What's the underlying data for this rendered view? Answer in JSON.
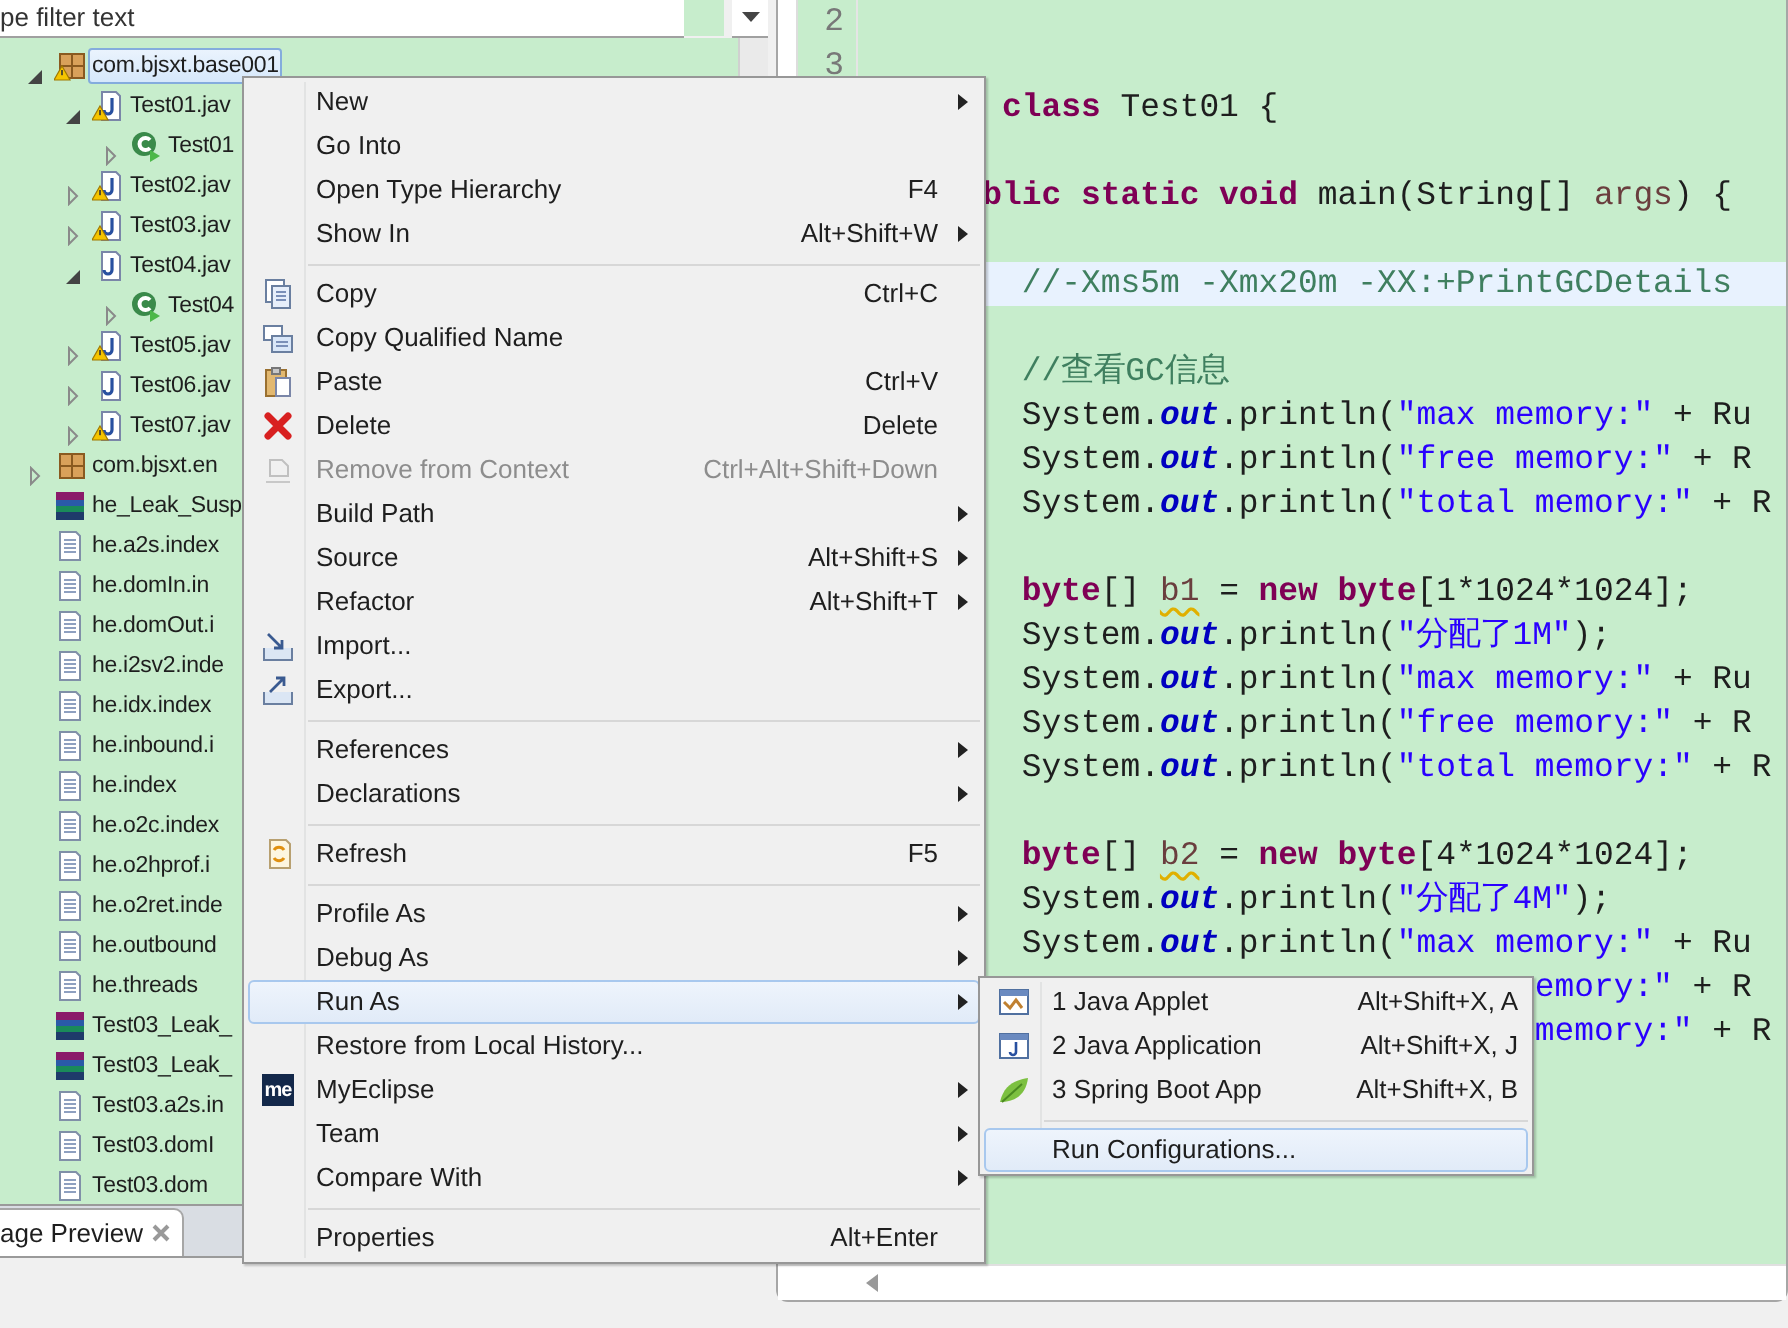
{
  "filter": {
    "placeholder": "pe filter text"
  },
  "tree": [
    {
      "label": "com.bjsxt.base001",
      "kind": "package",
      "warning": true,
      "expanded": true,
      "selected": true,
      "children": [
        {
          "label": "Test01.jav",
          "kind": "java",
          "warning": true,
          "expanded": true,
          "selected": false,
          "children": [
            {
              "label": "Test01",
              "kind": "runnable-class",
              "warning": false,
              "expanded": false,
              "selected": false
            }
          ]
        },
        {
          "label": "Test02.jav",
          "kind": "java",
          "warning": true,
          "expanded": false,
          "selected": false
        },
        {
          "label": "Test03.jav",
          "kind": "java",
          "warning": true,
          "expanded": false,
          "selected": false
        },
        {
          "label": "Test04.jav",
          "kind": "java",
          "warning": false,
          "expanded": true,
          "selected": false,
          "children": [
            {
              "label": "Test04",
              "kind": "runnable-class",
              "warning": false,
              "expanded": false,
              "selected": false
            }
          ]
        },
        {
          "label": "Test05.jav",
          "kind": "java",
          "warning": true,
          "expanded": false,
          "selected": false
        },
        {
          "label": "Test06.jav",
          "kind": "java",
          "warning": false,
          "expanded": false,
          "selected": false
        },
        {
          "label": "Test07.jav",
          "kind": "java",
          "warning": true,
          "expanded": false,
          "selected": false
        }
      ]
    },
    {
      "label": "com.bjsxt.en",
      "kind": "package",
      "warning": false,
      "expanded": false,
      "selected": false
    },
    {
      "label": "he_Leak_Susp",
      "kind": "archive",
      "warning": false,
      "selected": false
    },
    {
      "label": "he.a2s.index",
      "kind": "text",
      "warning": false,
      "selected": false
    },
    {
      "label": "he.domIn.in",
      "kind": "text",
      "warning": false,
      "selected": false
    },
    {
      "label": "he.domOut.i",
      "kind": "text",
      "warning": false,
      "selected": false
    },
    {
      "label": "he.i2sv2.inde",
      "kind": "text",
      "warning": false,
      "selected": false
    },
    {
      "label": "he.idx.index",
      "kind": "text",
      "warning": false,
      "selected": false
    },
    {
      "label": "he.inbound.i",
      "kind": "text",
      "warning": false,
      "selected": false
    },
    {
      "label": "he.index",
      "kind": "text",
      "warning": false,
      "selected": false
    },
    {
      "label": "he.o2c.index",
      "kind": "text",
      "warning": false,
      "selected": false
    },
    {
      "label": "he.o2hprof.i",
      "kind": "text",
      "warning": false,
      "selected": false
    },
    {
      "label": "he.o2ret.inde",
      "kind": "text",
      "warning": false,
      "selected": false
    },
    {
      "label": "he.outbound",
      "kind": "text",
      "warning": false,
      "selected": false
    },
    {
      "label": "he.threads",
      "kind": "text",
      "warning": false,
      "selected": false
    },
    {
      "label": "Test03_Leak_",
      "kind": "archive",
      "warning": false,
      "selected": false
    },
    {
      "label": "Test03_Leak_",
      "kind": "archive",
      "warning": false,
      "selected": false
    },
    {
      "label": "Test03.a2s.in",
      "kind": "text",
      "warning": false,
      "selected": false
    },
    {
      "label": "Test03.domI",
      "kind": "text",
      "warning": false,
      "selected": false
    },
    {
      "label": "Test03.dom",
      "kind": "text",
      "warning": false,
      "selected": false
    }
  ],
  "bottom_tab": {
    "label": "age Preview"
  },
  "editor": {
    "line_numbers": [
      "2",
      "3"
    ],
    "lines": [
      {
        "kind": "class",
        "highlighted": false,
        "tokens": [
          {
            "kind": "keyword",
            "text": "class"
          },
          {
            "kind": "plain",
            "text": " Test01 {"
          }
        ]
      },
      {
        "kind": "blank",
        "highlighted": false
      },
      {
        "kind": "method",
        "highlighted": false,
        "tokens": [
          {
            "kind": "keyword",
            "text": "blic static void"
          },
          {
            "kind": "plain",
            "text": " main(String[] "
          },
          {
            "kind": "param",
            "text": "args"
          },
          {
            "kind": "plain",
            "text": ") {"
          }
        ]
      },
      {
        "kind": "blank",
        "highlighted": false
      },
      {
        "kind": "body",
        "highlighted": true,
        "tokens": [
          {
            "kind": "comment",
            "text": "//-Xms5m -Xmx20m -XX:+PrintGCDetails"
          }
        ]
      },
      {
        "kind": "blank",
        "highlighted": false
      },
      {
        "kind": "body",
        "highlighted": false,
        "tokens": [
          {
            "kind": "comment",
            "text": "//查看GC信息"
          }
        ]
      },
      {
        "kind": "body",
        "highlighted": false,
        "tokens": [
          {
            "kind": "plain",
            "text": "System."
          },
          {
            "kind": "field",
            "text": "out"
          },
          {
            "kind": "plain",
            "text": ".println("
          },
          {
            "kind": "string",
            "text": "\"max memory:\""
          },
          {
            "kind": "plain",
            "text": " + Ru"
          }
        ]
      },
      {
        "kind": "body",
        "highlighted": false,
        "tokens": [
          {
            "kind": "plain",
            "text": "System."
          },
          {
            "kind": "field",
            "text": "out"
          },
          {
            "kind": "plain",
            "text": ".println("
          },
          {
            "kind": "string",
            "text": "\"free memory:\""
          },
          {
            "kind": "plain",
            "text": " + R"
          }
        ]
      },
      {
        "kind": "body",
        "highlighted": false,
        "tokens": [
          {
            "kind": "plain",
            "text": "System."
          },
          {
            "kind": "field",
            "text": "out"
          },
          {
            "kind": "plain",
            "text": ".println("
          },
          {
            "kind": "string",
            "text": "\"total memory:\""
          },
          {
            "kind": "plain",
            "text": " + R"
          }
        ]
      },
      {
        "kind": "blank",
        "highlighted": false
      },
      {
        "kind": "body",
        "highlighted": false,
        "tokens": [
          {
            "kind": "keyword",
            "text": "byte"
          },
          {
            "kind": "plain",
            "text": "[] "
          },
          {
            "kind": "warning-var",
            "text": "b1"
          },
          {
            "kind": "plain",
            "text": " = "
          },
          {
            "kind": "keyword",
            "text": "new byte"
          },
          {
            "kind": "plain",
            "text": "[1*1024*1024];"
          }
        ]
      },
      {
        "kind": "body",
        "highlighted": false,
        "tokens": [
          {
            "kind": "plain",
            "text": "System."
          },
          {
            "kind": "field",
            "text": "out"
          },
          {
            "kind": "plain",
            "text": ".println("
          },
          {
            "kind": "string",
            "text": "\"分配了1M\""
          },
          {
            "kind": "plain",
            "text": ");"
          }
        ]
      },
      {
        "kind": "body",
        "highlighted": false,
        "tokens": [
          {
            "kind": "plain",
            "text": "System."
          },
          {
            "kind": "field",
            "text": "out"
          },
          {
            "kind": "plain",
            "text": ".println("
          },
          {
            "kind": "string",
            "text": "\"max memory:\""
          },
          {
            "kind": "plain",
            "text": " + Ru"
          }
        ]
      },
      {
        "kind": "body",
        "highlighted": false,
        "tokens": [
          {
            "kind": "plain",
            "text": "System."
          },
          {
            "kind": "field",
            "text": "out"
          },
          {
            "kind": "plain",
            "text": ".println("
          },
          {
            "kind": "string",
            "text": "\"free memory:\""
          },
          {
            "kind": "plain",
            "text": " + R"
          }
        ]
      },
      {
        "kind": "body",
        "highlighted": false,
        "tokens": [
          {
            "kind": "plain",
            "text": "System."
          },
          {
            "kind": "field",
            "text": "out"
          },
          {
            "kind": "plain",
            "text": ".println("
          },
          {
            "kind": "string",
            "text": "\"total memory:\""
          },
          {
            "kind": "plain",
            "text": " + R"
          }
        ]
      },
      {
        "kind": "blank",
        "highlighted": false
      },
      {
        "kind": "body",
        "highlighted": false,
        "tokens": [
          {
            "kind": "keyword",
            "text": "byte"
          },
          {
            "kind": "plain",
            "text": "[] "
          },
          {
            "kind": "warning-var",
            "text": "b2"
          },
          {
            "kind": "plain",
            "text": " = "
          },
          {
            "kind": "keyword",
            "text": "new byte"
          },
          {
            "kind": "plain",
            "text": "[4*1024*1024];"
          }
        ]
      },
      {
        "kind": "body",
        "highlighted": false,
        "tokens": [
          {
            "kind": "plain",
            "text": "System."
          },
          {
            "kind": "field",
            "text": "out"
          },
          {
            "kind": "plain",
            "text": ".println("
          },
          {
            "kind": "string",
            "text": "\"分配了4M\""
          },
          {
            "kind": "plain",
            "text": ");"
          }
        ]
      },
      {
        "kind": "body",
        "highlighted": false,
        "tokens": [
          {
            "kind": "plain",
            "text": "System."
          },
          {
            "kind": "field",
            "text": "out"
          },
          {
            "kind": "plain",
            "text": ".println("
          },
          {
            "kind": "string",
            "text": "\"max memory:\""
          },
          {
            "kind": "plain",
            "text": " + Ru"
          }
        ]
      },
      {
        "kind": "cut",
        "highlighted": false,
        "tokens": [
          {
            "kind": "string",
            "text": "emory:\""
          },
          {
            "kind": "plain",
            "text": " + R"
          }
        ]
      },
      {
        "kind": "cut",
        "highlighted": false,
        "tokens": [
          {
            "kind": "string",
            "text": "memory:\""
          },
          {
            "kind": "plain",
            "text": " + R"
          }
        ]
      }
    ]
  },
  "context_menu": {
    "groups": [
      [
        {
          "label": "New",
          "has_submenu": true,
          "disabled": false,
          "selected": false
        },
        {
          "label": "Go Into",
          "has_submenu": false,
          "disabled": false,
          "selected": false
        },
        {
          "label": "Open Type Hierarchy",
          "shortcut": "F4",
          "has_submenu": false,
          "disabled": false,
          "selected": false
        },
        {
          "label": "Show In",
          "shortcut": "Alt+Shift+W",
          "has_submenu": true,
          "disabled": false,
          "selected": false
        }
      ],
      [
        {
          "label": "Copy",
          "kind": "copy",
          "shortcut": "Ctrl+C",
          "has_submenu": false,
          "disabled": false,
          "selected": false
        },
        {
          "label": "Copy Qualified Name",
          "kind": "copy-qualified",
          "has_submenu": false,
          "disabled": false,
          "selected": false
        },
        {
          "label": "Paste",
          "kind": "paste",
          "shortcut": "Ctrl+V",
          "has_submenu": false,
          "disabled": false,
          "selected": false
        },
        {
          "label": "Delete",
          "kind": "delete",
          "shortcut": "Delete",
          "has_submenu": false,
          "disabled": false,
          "selected": false
        },
        {
          "label": "Remove from Context",
          "kind": "remove",
          "shortcut": "Ctrl+Alt+Shift+Down",
          "has_submenu": false,
          "disabled": true,
          "selected": false
        },
        {
          "label": "Build Path",
          "has_submenu": true,
          "disabled": false,
          "selected": false
        },
        {
          "label": "Source",
          "shortcut": "Alt+Shift+S",
          "has_submenu": true,
          "disabled": false,
          "selected": false
        },
        {
          "label": "Refactor",
          "shortcut": "Alt+Shift+T",
          "has_submenu": true,
          "disabled": false,
          "selected": false
        },
        {
          "label": "Import...",
          "kind": "import",
          "has_submenu": false,
          "disabled": false,
          "selected": false
        },
        {
          "label": "Export...",
          "kind": "export",
          "has_submenu": false,
          "disabled": false,
          "selected": false
        }
      ],
      [
        {
          "label": "References",
          "has_submenu": true,
          "disabled": false,
          "selected": false
        },
        {
          "label": "Declarations",
          "has_submenu": true,
          "disabled": false,
          "selected": false
        }
      ],
      [
        {
          "label": "Refresh",
          "kind": "refresh",
          "shortcut": "F5",
          "has_submenu": false,
          "disabled": false,
          "selected": false
        }
      ],
      [
        {
          "label": "Profile As",
          "has_submenu": true,
          "disabled": false,
          "selected": false
        },
        {
          "label": "Debug As",
          "has_submenu": true,
          "disabled": false,
          "selected": false
        },
        {
          "label": "Run As",
          "has_submenu": true,
          "disabled": false,
          "selected": true
        },
        {
          "label": "Restore from Local History...",
          "has_submenu": false,
          "disabled": false,
          "selected": false
        },
        {
          "label": "MyEclipse",
          "kind": "badge",
          "badge": "me",
          "has_submenu": true,
          "disabled": false,
          "selected": false
        },
        {
          "label": "Team",
          "has_submenu": true,
          "disabled": false,
          "selected": false
        },
        {
          "label": "Compare With",
          "has_submenu": true,
          "disabled": false,
          "selected": false
        }
      ],
      [
        {
          "label": "Properties",
          "shortcut": "Alt+Enter",
          "has_submenu": false,
          "disabled": false,
          "selected": false
        }
      ]
    ]
  },
  "run_as_submenu": {
    "groups": [
      [
        {
          "label": "1 Java Applet",
          "kind": "applet",
          "shortcut": "Alt+Shift+X, A",
          "selected": false
        },
        {
          "label": "2 Java Application",
          "kind": "application",
          "shortcut": "Alt+Shift+X, J",
          "selected": false
        },
        {
          "label": "3 Spring Boot App",
          "kind": "leaf",
          "shortcut": "Alt+Shift+X, B",
          "selected": false
        }
      ],
      [
        {
          "label": "Run Configurations...",
          "selected": true
        }
      ]
    ]
  }
}
